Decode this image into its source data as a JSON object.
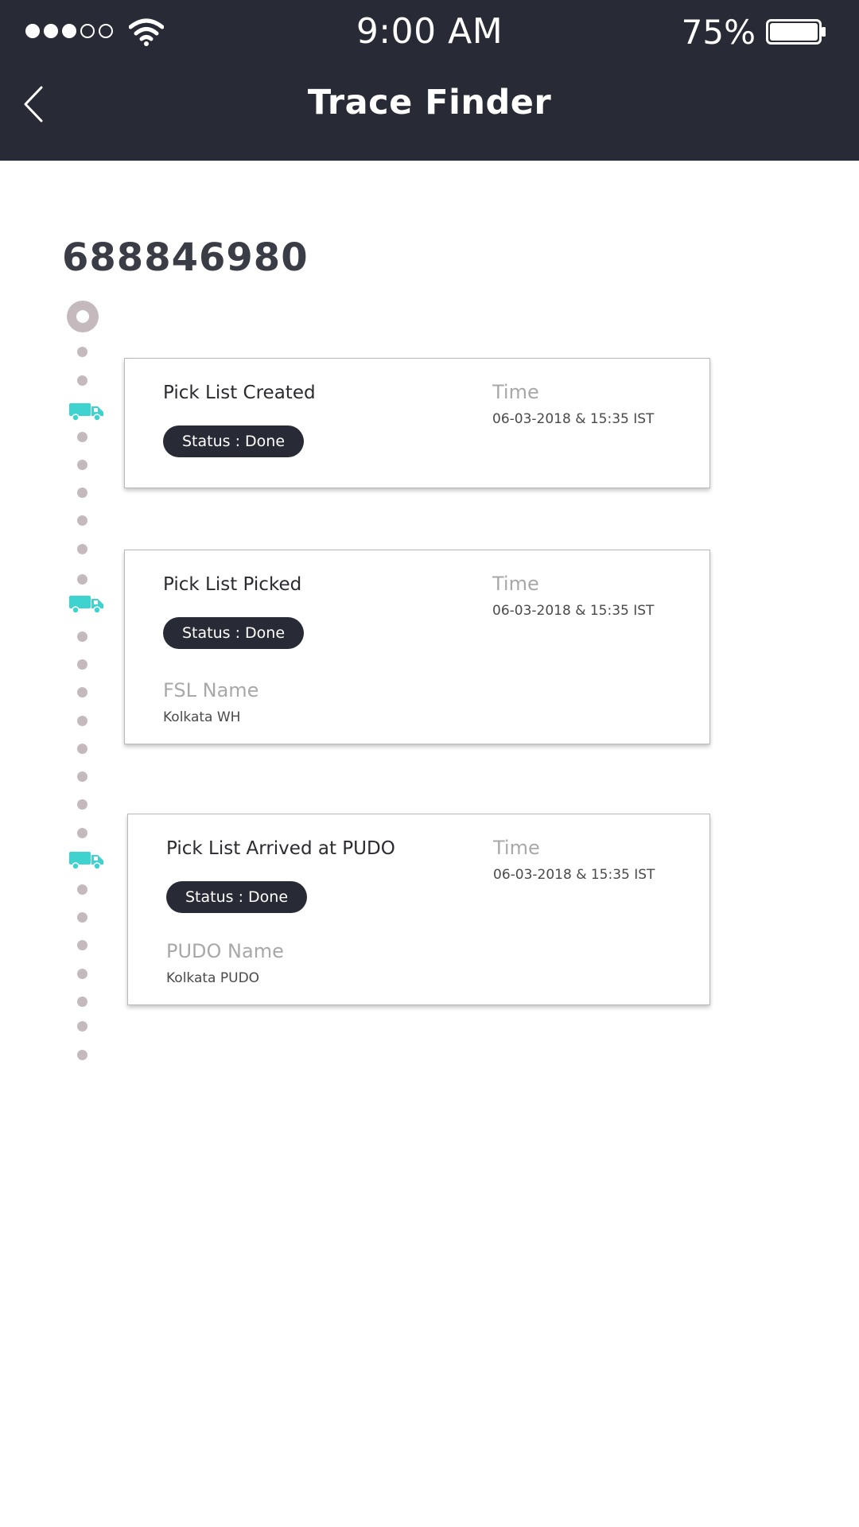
{
  "status_bar": {
    "time": "9:00 AM",
    "battery_percent": "75%",
    "signal_strength": {
      "filled": 3,
      "total": 5
    },
    "battery_level": 0.75,
    "icons": [
      "signal-icon",
      "wifi-icon",
      "battery-icon"
    ]
  },
  "header": {
    "title": "Trace Finder",
    "back_icon": "chevron-left-icon"
  },
  "tracking_number": "688846980",
  "colors": {
    "header_bg": "#282b35",
    "accent_truck": "#3fd3d0",
    "timeline_dot": "#c4babe",
    "status_pill_bg": "#282b35"
  },
  "events": [
    {
      "title": "Pick List Created",
      "status": "Status : Done",
      "time_label": "Time",
      "time_value": "06-03-2018 & 15:35 IST",
      "icon": "truck-icon"
    },
    {
      "title": "Pick List Picked",
      "status": "Status : Done",
      "time_label": "Time",
      "time_value": "06-03-2018 & 15:35 IST",
      "extra_label": "FSL Name",
      "extra_value": "Kolkata WH",
      "icon": "truck-icon"
    },
    {
      "title": "Pick List Arrived at PUDO",
      "status": "Status : Done",
      "time_label": "Time",
      "time_value": "06-03-2018 & 15:35 IST",
      "extra_label": "PUDO Name",
      "extra_value": "Kolkata PUDO",
      "icon": "truck-icon"
    }
  ]
}
